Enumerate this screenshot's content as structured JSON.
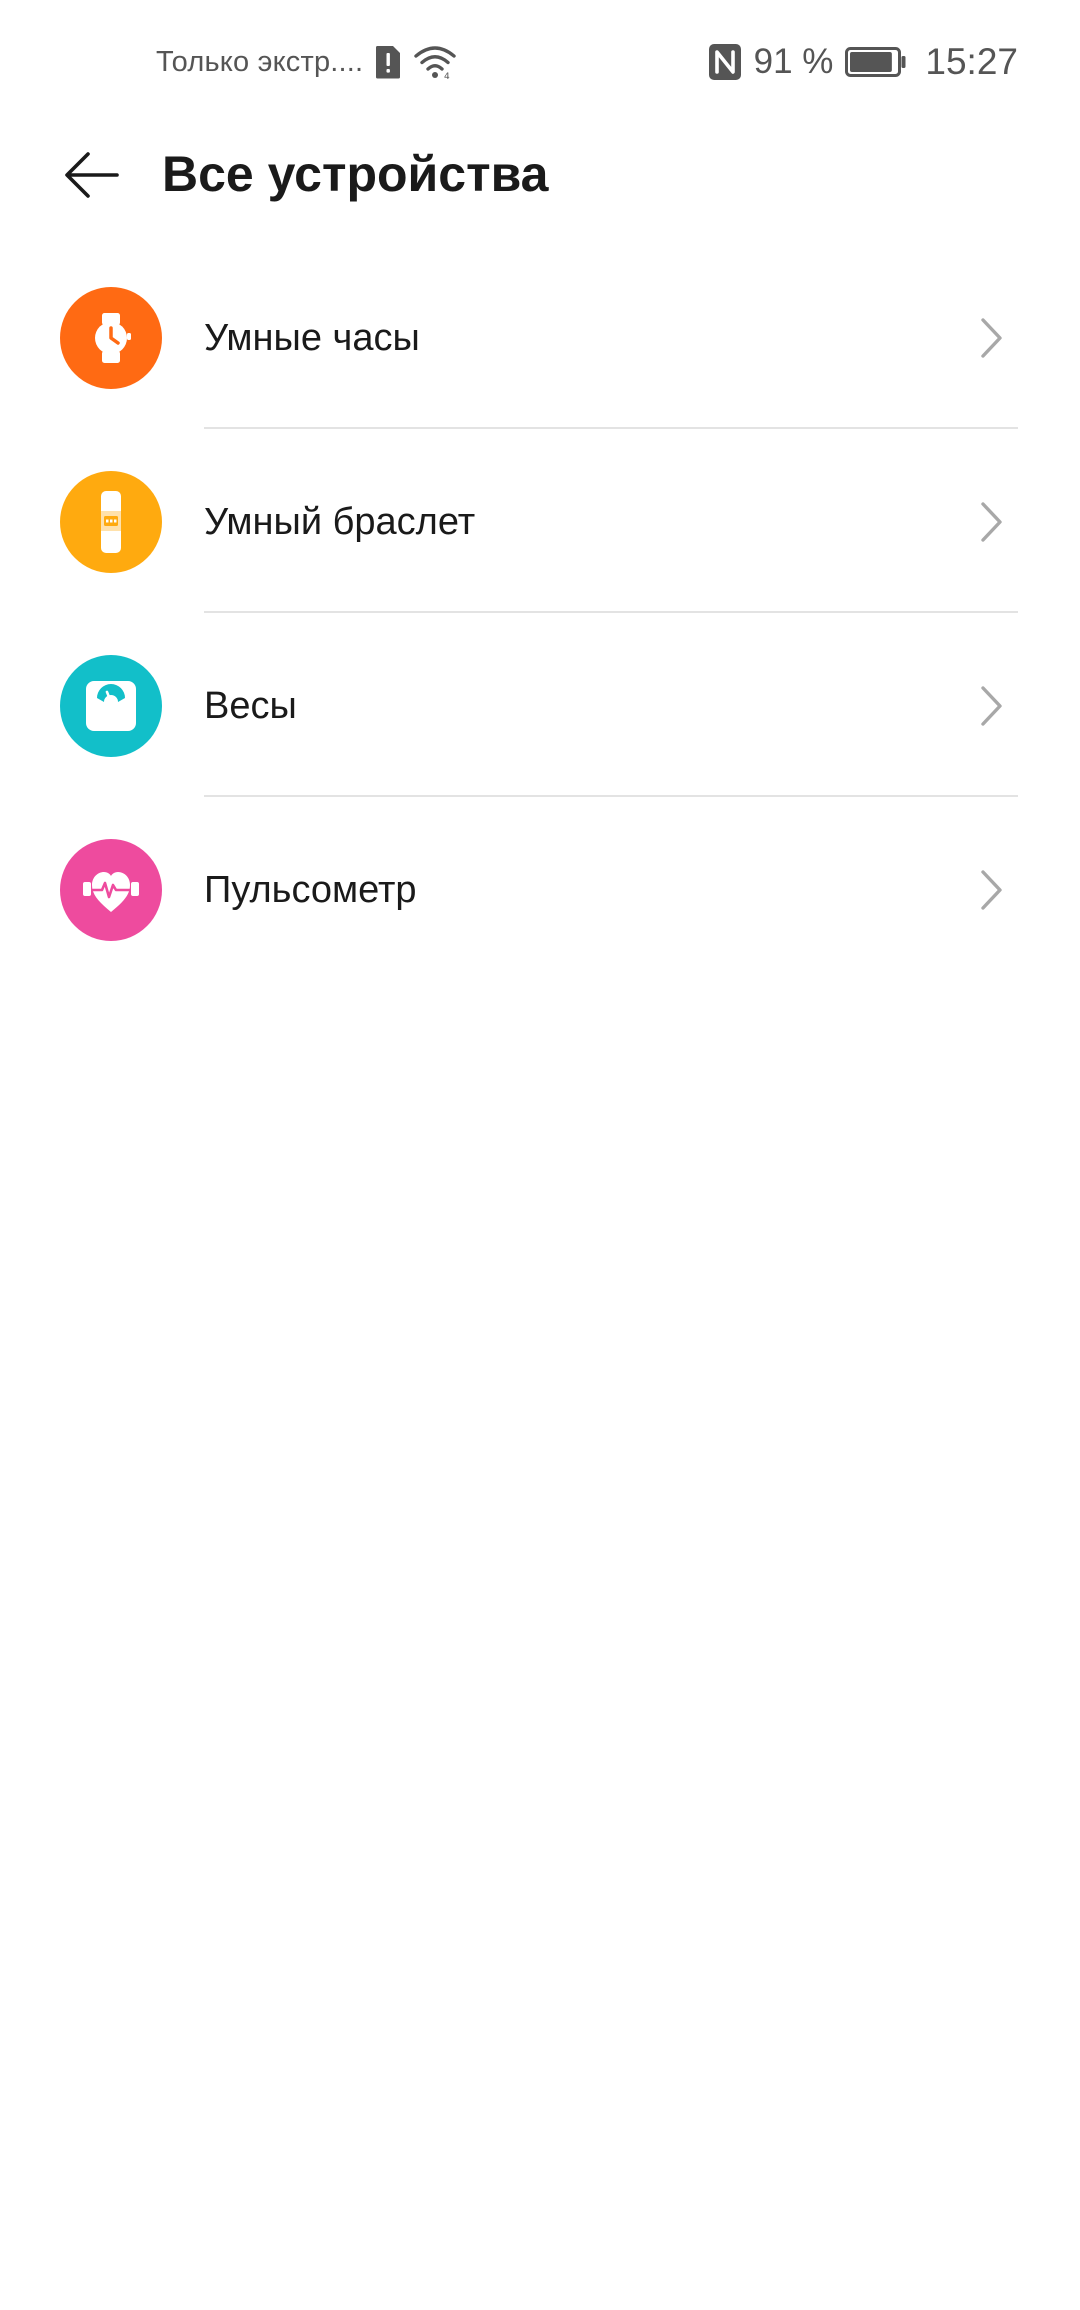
{
  "status_bar": {
    "carrier_text": "Только экстр....",
    "icons": [
      "sim-alert-icon",
      "wifi-icon",
      "nfc-icon",
      "battery-icon"
    ],
    "battery_text": "91 %",
    "battery_level": 0.91,
    "time": "15:27"
  },
  "header": {
    "back_icon": "arrow-left-icon",
    "title": "Все устройства"
  },
  "devices": [
    {
      "label": "Умные часы",
      "icon": "watch-icon",
      "color": "#FF6A13"
    },
    {
      "label": "Умный браслет",
      "icon": "band-icon",
      "color": "#FFAA0F"
    },
    {
      "label": "Весы",
      "icon": "scale-icon",
      "color": "#12BFC9"
    },
    {
      "label": "Пульсометр",
      "icon": "heart-rate-icon",
      "color": "#EE4B9E"
    }
  ],
  "chevron_icon": "chevron-right-icon"
}
